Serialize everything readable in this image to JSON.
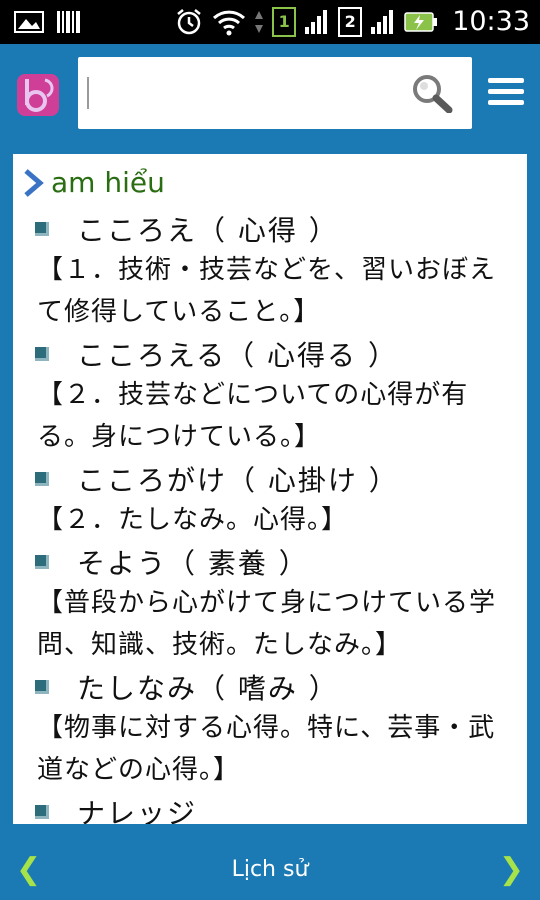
{
  "status_bar": {
    "time": "10:33",
    "sim1_label": "1",
    "sim2_label": "2"
  },
  "search": {
    "placeholder": ""
  },
  "word": {
    "title": "am hiểu"
  },
  "entries": [
    {
      "head": "こころえ（ 心得 ）",
      "definition": "【１．技術・技芸などを、習いおぼえて修得していること。】"
    },
    {
      "head": "こころえる（ 心得る ）",
      "definition": "【２．技芸などについての心得が有る。身につけている。】"
    },
    {
      "head": "こころがけ（ 心掛け ）",
      "definition": "【２．たしなみ。心得。】"
    },
    {
      "head": "そよう（ 素養 ）",
      "definition": "【普段から心がけて身につけている学問、知識、技術。たしなみ。】"
    },
    {
      "head": "たしなみ（ 嗜み ）",
      "definition": "【物事に対する心得。特に、芸事・武道などの心得。】"
    },
    {
      "head": "ナレッジ",
      "definition": ""
    }
  ],
  "bottom_bar": {
    "prev_label": "❮",
    "history_label": "Lịch sử",
    "next_label": "❯"
  },
  "colors": {
    "brand": "#1b79b3",
    "word_title": "#2a6d12",
    "nav_arrow": "#a6e24a"
  }
}
